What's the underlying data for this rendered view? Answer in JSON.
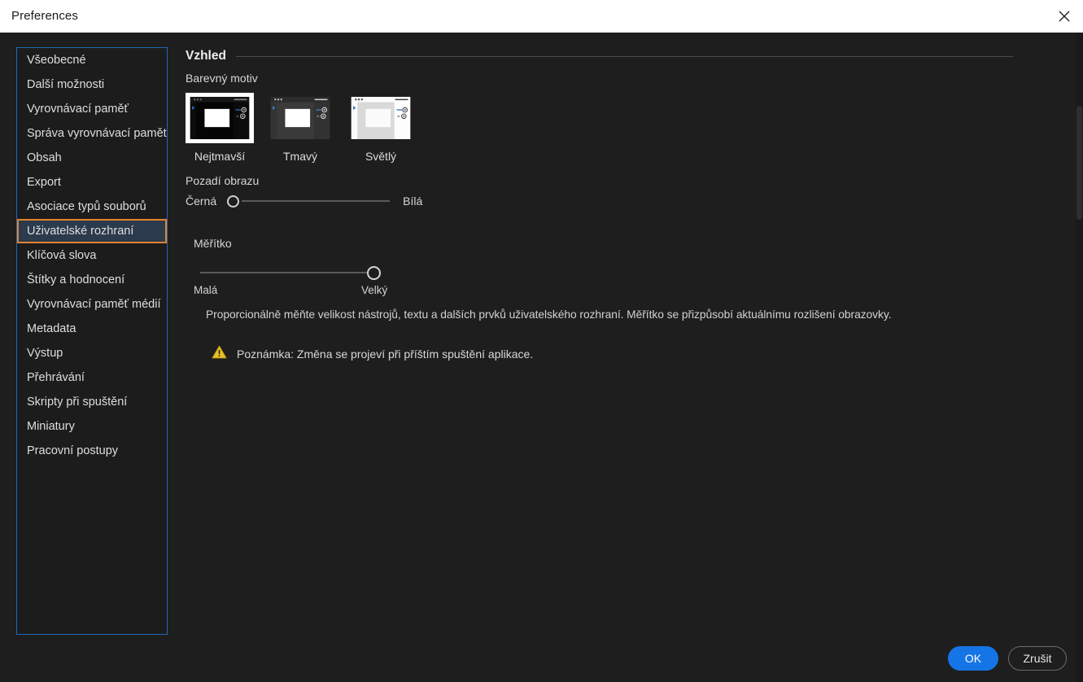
{
  "window": {
    "title": "Preferences",
    "close_icon": "close-icon"
  },
  "sidebar": {
    "items": [
      {
        "label": "Všeobecné",
        "selected": false
      },
      {
        "label": "Další možnosti",
        "selected": false
      },
      {
        "label": "Vyrovnávací paměť",
        "selected": false
      },
      {
        "label": "Správa vyrovnávací paměti",
        "selected": false
      },
      {
        "label": "Obsah",
        "selected": false
      },
      {
        "label": "Export",
        "selected": false
      },
      {
        "label": "Asociace typů souborů",
        "selected": false
      },
      {
        "label": "Uživatelské rozhraní",
        "selected": true
      },
      {
        "label": "Klíčová slova",
        "selected": false
      },
      {
        "label": "Štítky a hodnocení",
        "selected": false
      },
      {
        "label": "Vyrovnávací paměť médií",
        "selected": false
      },
      {
        "label": "Metadata",
        "selected": false
      },
      {
        "label": "Výstup",
        "selected": false
      },
      {
        "label": "Přehrávání",
        "selected": false
      },
      {
        "label": "Skripty při spuštění",
        "selected": false
      },
      {
        "label": "Miniatury",
        "selected": false
      },
      {
        "label": "Pracovní postupy",
        "selected": false
      }
    ]
  },
  "main": {
    "section_title": "Vzhled",
    "theme_label": "Barevný motiv",
    "themes": [
      {
        "name": "Nejtmavší",
        "selected": true
      },
      {
        "name": "Tmavý",
        "selected": false
      },
      {
        "name": "Světlý",
        "selected": false
      }
    ],
    "background": {
      "label": "Pozadí obrazu",
      "min_label": "Černá",
      "max_label": "Bílá",
      "value_percent": 0
    },
    "scale": {
      "label": "Měřítko",
      "min_label": "Malá",
      "max_label": "Velký",
      "value_percent": 100
    },
    "description": "Proporcionálně měňte velikost nástrojů, textu a dalších prvků uživatelského rozhraní. Měřítko se přizpůsobí aktuálnímu rozlišení obrazovky.",
    "note": {
      "icon": "warning-triangle-icon",
      "text": "Poznámka: Změna se projeví při příštím spuštění aplikace."
    }
  },
  "footer": {
    "ok_label": "OK",
    "cancel_label": "Zrušit"
  },
  "colors": {
    "accent_blue": "#1575e6",
    "selection_border_orange": "#e3822c",
    "selection_fill": "#2b3a4c",
    "list_border_blue": "#1f69b5",
    "warning_yellow": "#e8c02a"
  }
}
